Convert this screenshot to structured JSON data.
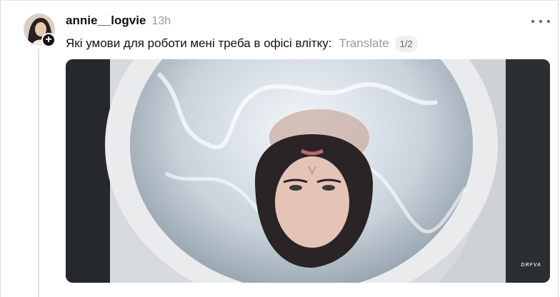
{
  "post": {
    "username": "annie__logvie",
    "timestamp": "13h",
    "text": "Які умови для роботи мені треба в офісі влітку:",
    "translate_label": "Translate",
    "page_indicator": "1/2"
  },
  "media": {
    "watermark": "DRFVA"
  },
  "icons": {
    "more": "more-horizontal-icon",
    "follow": "plus-icon"
  },
  "colors": {
    "text": "#111111",
    "muted": "#9a9a9a",
    "thread_line": "#e3e3e3"
  }
}
